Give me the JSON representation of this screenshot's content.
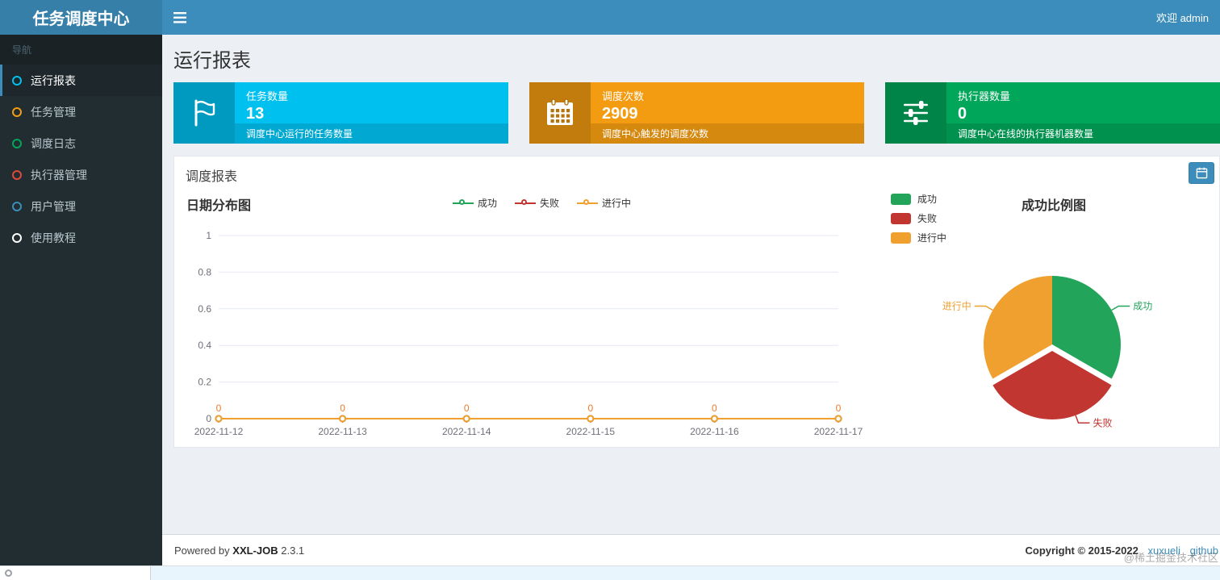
{
  "header": {
    "brand": "任务调度中心",
    "menu_icon": "bars-icon",
    "welcome": "欢迎 admin"
  },
  "sidebar": {
    "nav_label": "导航",
    "items": [
      {
        "id": "run-report",
        "label": "运行报表",
        "icon_color": "#00c0ef",
        "active": true
      },
      {
        "id": "job-manage",
        "label": "任务管理",
        "icon_color": "#f39c12",
        "active": false
      },
      {
        "id": "schedule-log",
        "label": "调度日志",
        "icon_color": "#00a65a",
        "active": false
      },
      {
        "id": "executor-manage",
        "label": "执行器管理",
        "icon_color": "#dd4b39",
        "active": false
      },
      {
        "id": "user-manage",
        "label": "用户管理",
        "icon_color": "#3c8dbc",
        "active": false
      },
      {
        "id": "tutorial",
        "label": "使用教程",
        "icon_color": "#ffffff",
        "active": false
      }
    ]
  },
  "main": {
    "page_title": "运行报表",
    "info_boxes": [
      {
        "icon": "flag-icon",
        "title": "任务数量",
        "value": "13",
        "footer": "调度中心运行的任务数量",
        "color": "#00c0ef"
      },
      {
        "icon": "calendar-icon",
        "title": "调度次数",
        "value": "2909",
        "footer": "调度中心触发的调度次数",
        "color": "#f39c12"
      },
      {
        "icon": "sliders-icon",
        "title": "执行器数量",
        "value": "0",
        "footer": "调度中心在线的执行器机器数量",
        "color": "#00a65a"
      }
    ],
    "panel": {
      "title": "调度报表",
      "date_button_icon": "calendar-icon"
    }
  },
  "chart_data": [
    {
      "type": "line",
      "title": "日期分布图",
      "x": [
        "2022-11-12",
        "2022-11-13",
        "2022-11-14",
        "2022-11-15",
        "2022-11-16",
        "2022-11-17"
      ],
      "series": [
        {
          "name": "成功",
          "color": "#23A45B",
          "values": [
            0,
            0,
            0,
            0,
            0,
            0
          ]
        },
        {
          "name": "失败",
          "color": "#C23632",
          "values": [
            0,
            0,
            0,
            0,
            0,
            0
          ]
        },
        {
          "name": "进行中",
          "color": "#F0A02F",
          "values": [
            0,
            0,
            0,
            0,
            0,
            0
          ]
        }
      ],
      "ylim": [
        0,
        1
      ],
      "yticks": [
        0,
        0.2,
        0.4,
        0.6,
        0.8,
        1
      ],
      "grid": true,
      "legend_position": "top",
      "label_color": "#EE7A2F"
    },
    {
      "type": "pie",
      "title": "成功比例图",
      "slices": [
        {
          "name": "成功",
          "value": 1,
          "color": "#23A45B",
          "selected": false
        },
        {
          "name": "失败",
          "value": 1,
          "color": "#C23632",
          "selected": true
        },
        {
          "name": "进行中",
          "value": 1,
          "color": "#F0A02F",
          "selected": false
        }
      ],
      "legend_position": "left"
    }
  ],
  "footer": {
    "powered_prefix": "Powered by",
    "brand": "XXL-JOB",
    "version": "2.3.1",
    "copyright": "Copyright © 2015-2022",
    "links": [
      {
        "label": "xuxueli"
      },
      {
        "label": "github"
      }
    ]
  },
  "watermark": "@稀土掘金技术社区"
}
